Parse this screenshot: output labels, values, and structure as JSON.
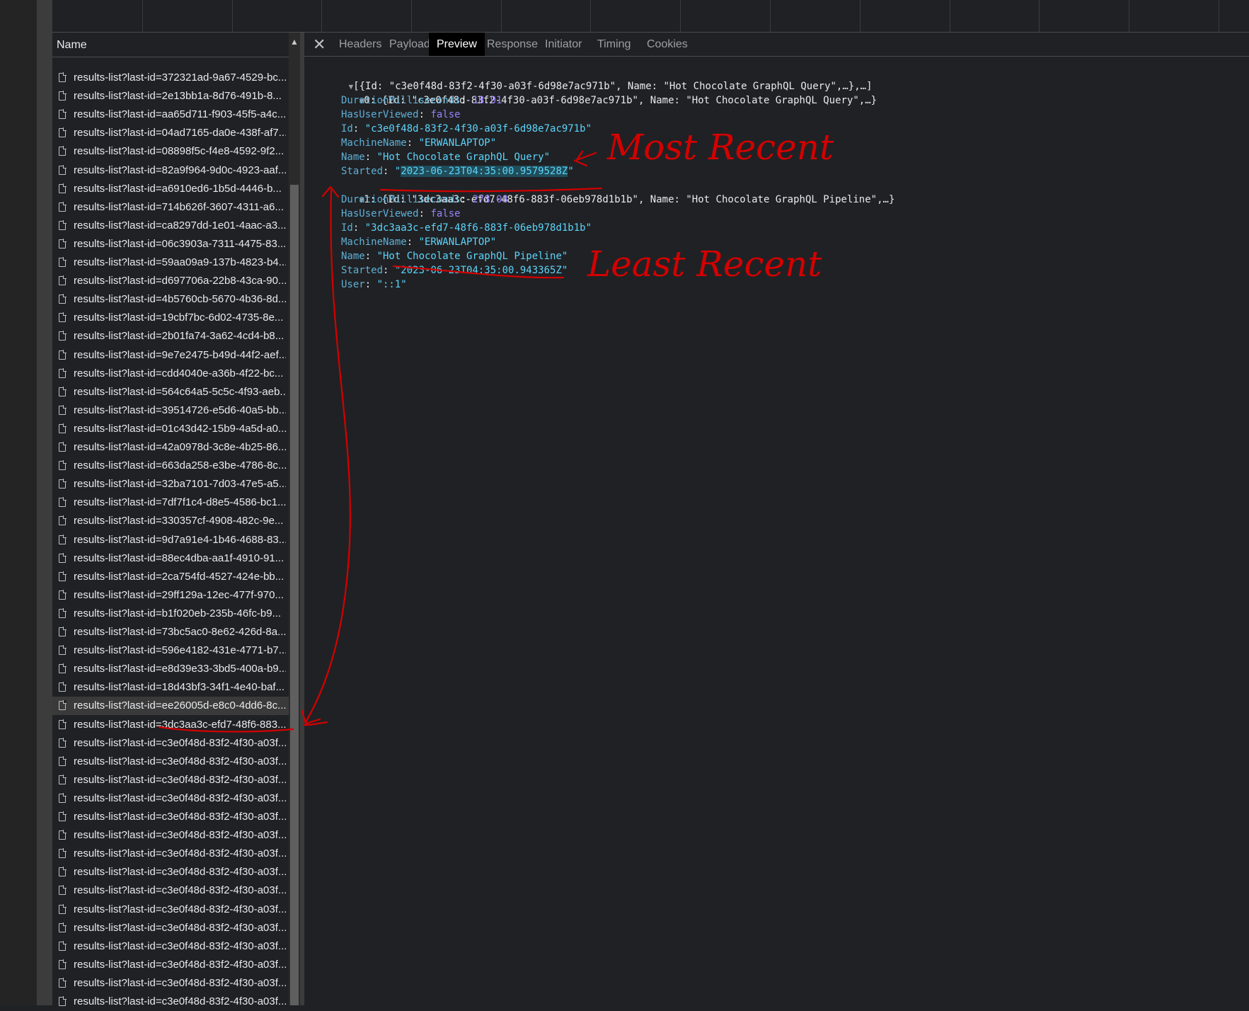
{
  "list": {
    "header": "Name",
    "rows": [
      "results-list?last-id=372321ad-9a67-4529-bc...",
      "results-list?last-id=2e13bb1a-8d76-491b-8...",
      "results-list?last-id=aa65d711-f903-45f5-a4c...",
      "results-list?last-id=04ad7165-da0e-438f-af7...",
      "results-list?last-id=08898f5c-f4e8-4592-9f2...",
      "results-list?last-id=82a9f964-9d0c-4923-aaf...",
      "results-list?last-id=a6910ed6-1b5d-4446-b...",
      "results-list?last-id=714b626f-3607-4311-a6...",
      "results-list?last-id=ca8297dd-1e01-4aac-a3...",
      "results-list?last-id=06c3903a-7311-4475-83...",
      "results-list?last-id=59aa09a9-137b-4823-b4...",
      "results-list?last-id=d697706a-22b8-43ca-90...",
      "results-list?last-id=4b5760cb-5670-4b36-8d...",
      "results-list?last-id=19cbf7bc-6d02-4735-8e...",
      "results-list?last-id=2b01fa74-3a62-4cd4-b8...",
      "results-list?last-id=9e7e2475-b49d-44f2-aef...",
      "results-list?last-id=cdd4040e-a36b-4f22-bc...",
      "results-list?last-id=564c64a5-5c5c-4f93-aeb...",
      "results-list?last-id=39514726-e5d6-40a5-bb...",
      "results-list?last-id=01c43d42-15b9-4a5d-a0...",
      "results-list?last-id=42a0978d-3c8e-4b25-86...",
      "results-list?last-id=663da258-e3be-4786-8c...",
      "results-list?last-id=32ba7101-7d03-47e5-a5...",
      "results-list?last-id=7df7f1c4-d8e5-4586-bc1...",
      "results-list?last-id=330357cf-4908-482c-9e...",
      "results-list?last-id=9d7a91e4-1b46-4688-83...",
      "results-list?last-id=88ec4dba-aa1f-4910-91...",
      "results-list?last-id=2ca754fd-4527-424e-bb...",
      "results-list?last-id=29ff129a-12ec-477f-970...",
      "results-list?last-id=b1f020eb-235b-46fc-b9...",
      "results-list?last-id=73bc5ac0-8e62-426d-8a...",
      "results-list?last-id=596e4182-431e-4771-b7...",
      "results-list?last-id=e8d39e33-3bd5-400a-b9...",
      "results-list?last-id=18d43bf3-34f1-4e40-baf...",
      "results-list?last-id=ee26005d-e8c0-4dd6-8c...",
      "results-list?last-id=3dc3aa3c-efd7-48f6-883...",
      "results-list?last-id=c3e0f48d-83f2-4f30-a03f...",
      "results-list?last-id=c3e0f48d-83f2-4f30-a03f...",
      "results-list?last-id=c3e0f48d-83f2-4f30-a03f...",
      "results-list?last-id=c3e0f48d-83f2-4f30-a03f...",
      "results-list?last-id=c3e0f48d-83f2-4f30-a03f...",
      "results-list?last-id=c3e0f48d-83f2-4f30-a03f...",
      "results-list?last-id=c3e0f48d-83f2-4f30-a03f...",
      "results-list?last-id=c3e0f48d-83f2-4f30-a03f...",
      "results-list?last-id=c3e0f48d-83f2-4f30-a03f...",
      "results-list?last-id=c3e0f48d-83f2-4f30-a03f...",
      "results-list?last-id=c3e0f48d-83f2-4f30-a03f...",
      "results-list?last-id=c3e0f48d-83f2-4f30-a03f...",
      "results-list?last-id=c3e0f48d-83f2-4f30-a03f...",
      "results-list?last-id=c3e0f48d-83f2-4f30-a03f...",
      "results-list?last-id=c3e0f48d-83f2-4f30-a03f..."
    ],
    "selected_row": "results-list?last-id=ee26005d-e8c0-4dd6-8c..."
  },
  "tabs": [
    "Headers",
    "Payload",
    "Preview",
    "Response",
    "Initiator",
    "Timing",
    "Cookies"
  ],
  "active_tab": "Preview",
  "preview": {
    "root_summary": "[{Id: \"c3e0f48d-83f2-4f30-a03f-6d98e7ac971b\", Name: \"Hot Chocolate GraphQL Query\",…},…]",
    "item0_summary_prefix": "0: {Id: ",
    "item0_summary_id": "\"c3e0f48d-83f2-4f30-a03f-6d98e7ac971b\"",
    "item0_summary_rest": ", Name: \"Hot Chocolate GraphQL Query\",…}",
    "item0": {
      "duration_key": "DurationMilliseconds",
      "duration_val": "18.91",
      "viewed_key": "HasUserViewed",
      "viewed_val": "false",
      "id_key": "Id",
      "id_val": "\"c3e0f48d-83f2-4f30-a03f-6d98e7ac971b\"",
      "machine_key": "MachineName",
      "machine_val": "\"ERWANLAPTOP\"",
      "name_key": "Name",
      "name_val": "\"Hot Chocolate GraphQL Query\"",
      "started_key": "Started",
      "started_q1": "\"",
      "started_val": "2023-06-23T04:35:00.9579528Z",
      "started_q2": "\""
    },
    "item1_summary_prefix": "1: {Id: ",
    "item1_summary_id": "\"3dc3aa3c-efd7-48f6-883f-06eb978d1b1b\"",
    "item1_summary_rest": ", Name: \"Hot Chocolate GraphQL Pipeline\",…}",
    "item1": {
      "duration_key": "DurationMilliseconds",
      "duration_val": "278.08",
      "viewed_key": "HasUserViewed",
      "viewed_val": "false",
      "id_key": "Id",
      "id_val": "\"3dc3aa3c-efd7-48f6-883f-06eb978d1b1b\"",
      "machine_key": "MachineName",
      "machine_val": "\"ERWANLAPTOP\"",
      "name_key": "Name",
      "name_val": "\"Hot Chocolate GraphQL Pipeline\"",
      "started_key": "Started",
      "started_val": "\"2023-06-23T04:35:00.943365Z\"",
      "user_key": "User",
      "user_val": "\"::1\""
    }
  },
  "annotations": {
    "most_recent": "Most Recent",
    "least_recent": "Least Recent",
    "ink_color": "#d40000"
  },
  "colors": {
    "background": "#202124",
    "key": "#5db0d7",
    "string": "#5cd5fb",
    "number": "#9980ff"
  }
}
